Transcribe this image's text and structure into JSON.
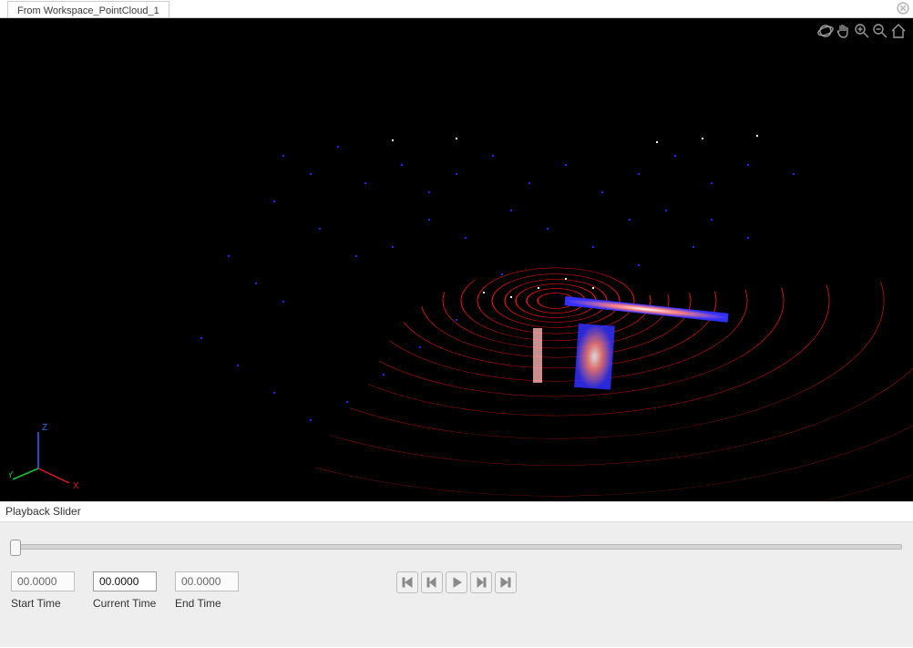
{
  "tab": {
    "label": "From Workspace_PointCloud_1"
  },
  "viewport": {
    "tools": [
      "orbit-icon",
      "pan-icon",
      "zoom-in-icon",
      "zoom-out-icon",
      "home-icon"
    ],
    "axes": {
      "x": "X",
      "y": "Y",
      "z": "Z",
      "x_color": "#e21a1a",
      "y_color": "#19c237",
      "z_color": "#2a6eff"
    }
  },
  "playback": {
    "title": "Playback Slider",
    "start": {
      "value": "00.0000",
      "label": "Start Time"
    },
    "current": {
      "value": "00.0000",
      "label": "Current Time"
    },
    "end": {
      "value": "00.0000",
      "label": "End Time"
    },
    "slider_pos": 0
  },
  "colors": {
    "ring": "#ff1a1a",
    "pointA": "#2525ff",
    "pointB": "#ffffff"
  }
}
